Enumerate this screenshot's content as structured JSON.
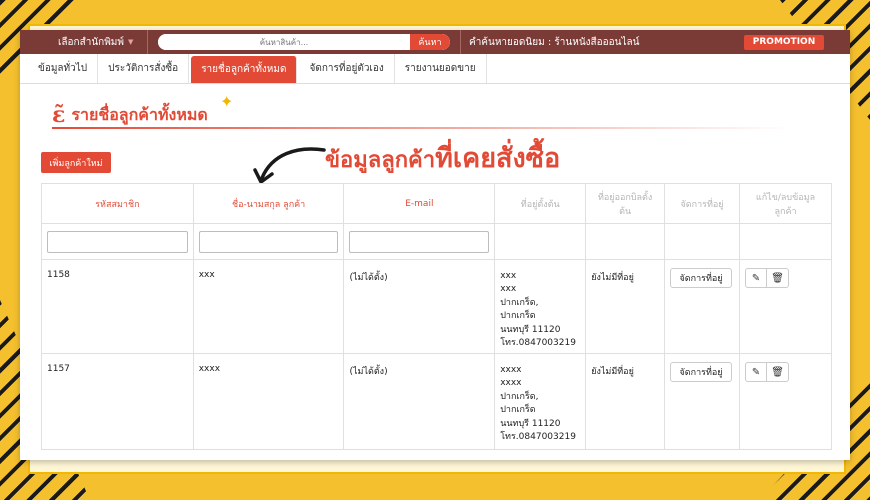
{
  "topbar": {
    "publisher_label": "เลือกสำนักพิมพ์",
    "search_placeholder": "ค้นหาสินค้า...",
    "search_button": "ค้นหา",
    "popular_text": "คำค้นหายอดนิยม : ร้านหนังสือออนไลน์",
    "promo_label": "PROMOTION"
  },
  "tabs": [
    {
      "label": "ข้อมูลทั่วไป"
    },
    {
      "label": "ประวัติการสั่งซื้อ"
    },
    {
      "label": "รายชื่อลูกค้าทั้งหมด"
    },
    {
      "label": "จัดการที่อยู่ตัวเอง"
    },
    {
      "label": "รายงานยอดขาย"
    }
  ],
  "page": {
    "title": "รายชื่อลูกค้าทั้งหมด",
    "annotation_part1": "ข้อมูลลูกค้า",
    "annotation_part2": "ที่เคยสั่งซื้อ",
    "add_button": "เพิ่มลูกค้าใหม่"
  },
  "table": {
    "headers": [
      "รหัสสมาชิก",
      "ชื่อ-นามสกุล ลูกค้า",
      "E-mail",
      "ที่อยู่ตั้งต้น",
      "ที่อยู่ออกบิลตั้งต้น",
      "จัดการที่อยู่",
      "แก้ไข/ลบข้อมูลลูกค้า"
    ],
    "manage_label": "จัดการที่อยู่",
    "rows": [
      {
        "id": "1158",
        "name": "xxx",
        "email": "(ไม่ได้ตั้ง)",
        "address": [
          "xxx",
          "xxx",
          "ปากเกร็ด,",
          "ปากเกร็ด",
          "นนทบุรี 11120",
          "โทร.0847003219"
        ],
        "billing": "ยังไม่มีที่อยู่"
      },
      {
        "id": "1157",
        "name": "xxxx",
        "email": "(ไม่ได้ตั้ง)",
        "address": [
          "xxxx",
          "xxxx",
          "ปากเกร็ด,",
          "ปากเกร็ด",
          "นนทบุรี 11120",
          "โทร.0847003219"
        ],
        "billing": "ยังไม่มีที่อยู่"
      }
    ]
  },
  "colors": {
    "accent": "#e24a36",
    "topbar": "#7a3a35",
    "background": "#f5c02e"
  }
}
